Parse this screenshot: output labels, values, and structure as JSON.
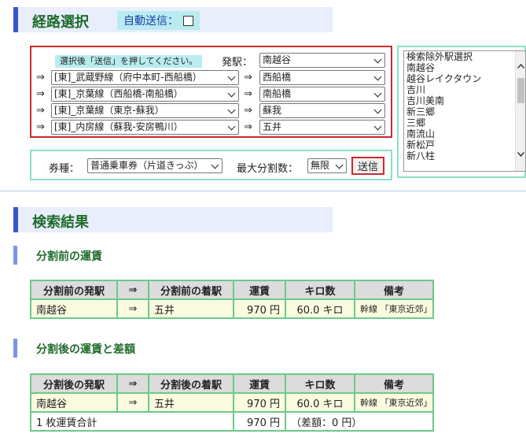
{
  "route": {
    "title": "経路選択",
    "auto_send_label": "自動送信：",
    "hint": "選択後「送信」を押してください。",
    "start_label": "発駅：",
    "start_station": "南越谷",
    "arrow": "⇒",
    "legs": [
      {
        "line": "[東]_武蔵野線（府中本町-西船橋）",
        "station": "西船橋"
      },
      {
        "line": "[東]_京葉線（西船橋-南船橋）",
        "station": "南船橋"
      },
      {
        "line": "[東]_京葉線（東京-蘇我）",
        "station": "蘇我"
      },
      {
        "line": "[東]_内房線（蘇我-安房鴨川）",
        "station": "五井"
      }
    ],
    "ticket_label": "券種：",
    "ticket_value": "普通乗車券（片道きっぷ）",
    "max_split_label": "最大分割数：",
    "max_split_value": "無限",
    "submit_label": "送信"
  },
  "exclude_list": {
    "items": [
      "検索除外駅選択",
      "南越谷",
      "越谷レイクタウン",
      "吉川",
      "吉川美南",
      "新三郷",
      "三郷",
      "南流山",
      "新松戸",
      "新八柱"
    ]
  },
  "results": {
    "title": "検索結果",
    "before": {
      "title": "分割前の運賃",
      "headers": [
        "分割前の発駅",
        "⇒",
        "分割前の着駅",
        "運賃",
        "キロ数",
        "備考"
      ],
      "row": {
        "from": "南越谷",
        "arrow": "⇒",
        "to": "五井",
        "fare": "970 円",
        "km": "60.0 キロ",
        "note": "幹線 「東京近郊」"
      }
    },
    "after": {
      "title": "分割後の運賃と差額",
      "headers": [
        "分割後の発駅",
        "⇒",
        "分割後の着駅",
        "運賃",
        "キロ数",
        "備考"
      ],
      "row": {
        "from": "南越谷",
        "arrow": "⇒",
        "to": "五井",
        "fare": "970 円",
        "km": "60.0 キロ",
        "note": "幹線 「東京近郊」"
      },
      "total": {
        "label": "1 枚運賃合計",
        "fare": "970 円",
        "diff": "（差額：0 円）"
      }
    }
  }
}
